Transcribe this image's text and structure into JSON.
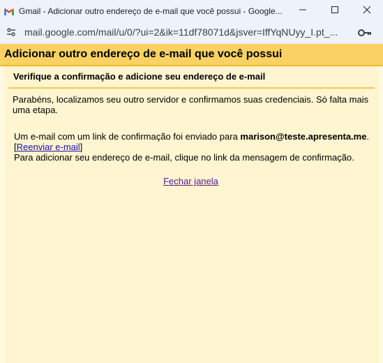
{
  "window": {
    "title": "Gmail - Adicionar outro endereço de e-mail que você possui - Google...",
    "url": "mail.google.com/mail/u/0/?ui=2&ik=11df78071d&jsver=IffYqNUyy_I.pt_..."
  },
  "page": {
    "header": "Adicionar outro endereço de e-mail que você possui",
    "step_title": "Verifique a confirmação e adicione seu endereço de e-mail",
    "congrats": "Parabéns, localizamos seu outro servidor e confirmamos suas credenciais. Só falta mais uma etapa.",
    "sent_prefix": "Um e-mail com um link de confirmação foi enviado para ",
    "email": "marison@teste.apresenta.me",
    "sent_suffix": ".",
    "bracket_open": "[",
    "resend_label": "Reenviar e-mail",
    "bracket_close": "]",
    "instruction": "Para adicionar seu endereço de e-mail, clique no link da mensagem de confirmação.",
    "close_label": "Fechar janela"
  },
  "icons": {
    "app": "gmail-logo-icon",
    "site_info": "site-settings-icon",
    "password": "key-icon",
    "minimize": "minimize-icon",
    "maximize": "maximize-icon",
    "close": "close-icon"
  },
  "colors": {
    "header_bg": "#fad163",
    "panel_bg": "#fff5d1",
    "page_bg": "#fff9e0",
    "divider": "#f4c84e",
    "link": "#1a0dab",
    "visited_link": "#551a8b"
  }
}
